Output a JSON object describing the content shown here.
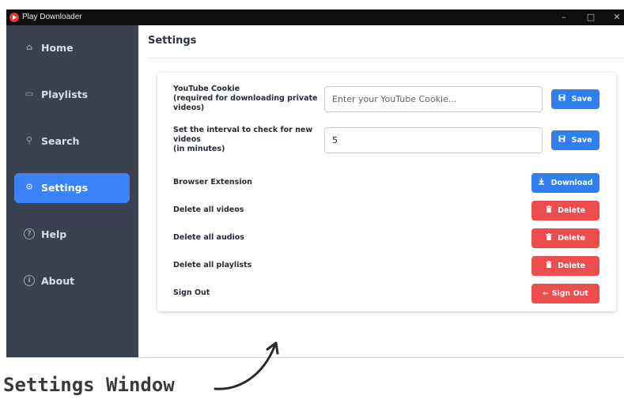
{
  "window": {
    "title": "Play Downloader",
    "controls": {
      "minimize": "–",
      "maximize": "□",
      "close": "✕"
    }
  },
  "sidebar": {
    "items": [
      {
        "label": "Home",
        "icon": "home-icon",
        "glyph": "⌂",
        "active": false
      },
      {
        "label": "Playlists",
        "icon": "playlist-icon",
        "glyph": "▭",
        "active": false
      },
      {
        "label": "Search",
        "icon": "search-icon",
        "glyph": "⚲",
        "active": false
      },
      {
        "label": "Settings",
        "icon": "gear-icon",
        "glyph": "⚙",
        "active": true
      },
      {
        "label": "Help",
        "icon": "help-icon",
        "glyph": "?",
        "active": false
      },
      {
        "label": "About",
        "icon": "info-icon",
        "glyph": "i",
        "active": false
      }
    ]
  },
  "main": {
    "title": "Settings",
    "settings": {
      "cookie": {
        "label_line1": "YouTube Cookie",
        "label_line2": "(required for downloading private",
        "label_line3": "videos)",
        "placeholder": "Enter your YouTube Cookie...",
        "value": "",
        "button": "Save",
        "button_icon": "save-icon"
      },
      "interval": {
        "label_line1": "Set the interval to check for new",
        "label_line2": "videos",
        "label_line3": "(in minutes)",
        "value": "5",
        "button": "Save",
        "button_icon": "save-icon"
      },
      "extension": {
        "label": "Browser Extension",
        "button": "Download",
        "button_icon": "download-icon"
      },
      "delete_videos": {
        "label": "Delete all videos",
        "button": "Delete",
        "button_icon": "trash-icon"
      },
      "delete_audios": {
        "label": "Delete all audios",
        "button": "Delete",
        "button_icon": "trash-icon"
      },
      "delete_playlists": {
        "label": "Delete all playlists",
        "button": "Delete",
        "button_icon": "trash-icon"
      },
      "sign_out": {
        "label": "Sign Out",
        "button": "Sign Out",
        "button_icon": "arrow-left-icon"
      }
    }
  },
  "annotation": {
    "text": "Settings Window"
  },
  "colors": {
    "sidebar_bg": "#3a4250",
    "accent_blue": "#3b82f6",
    "button_blue": "#2f7ff0",
    "danger_red": "#ee4d4d",
    "titlebar_bg": "#0f0f12"
  }
}
